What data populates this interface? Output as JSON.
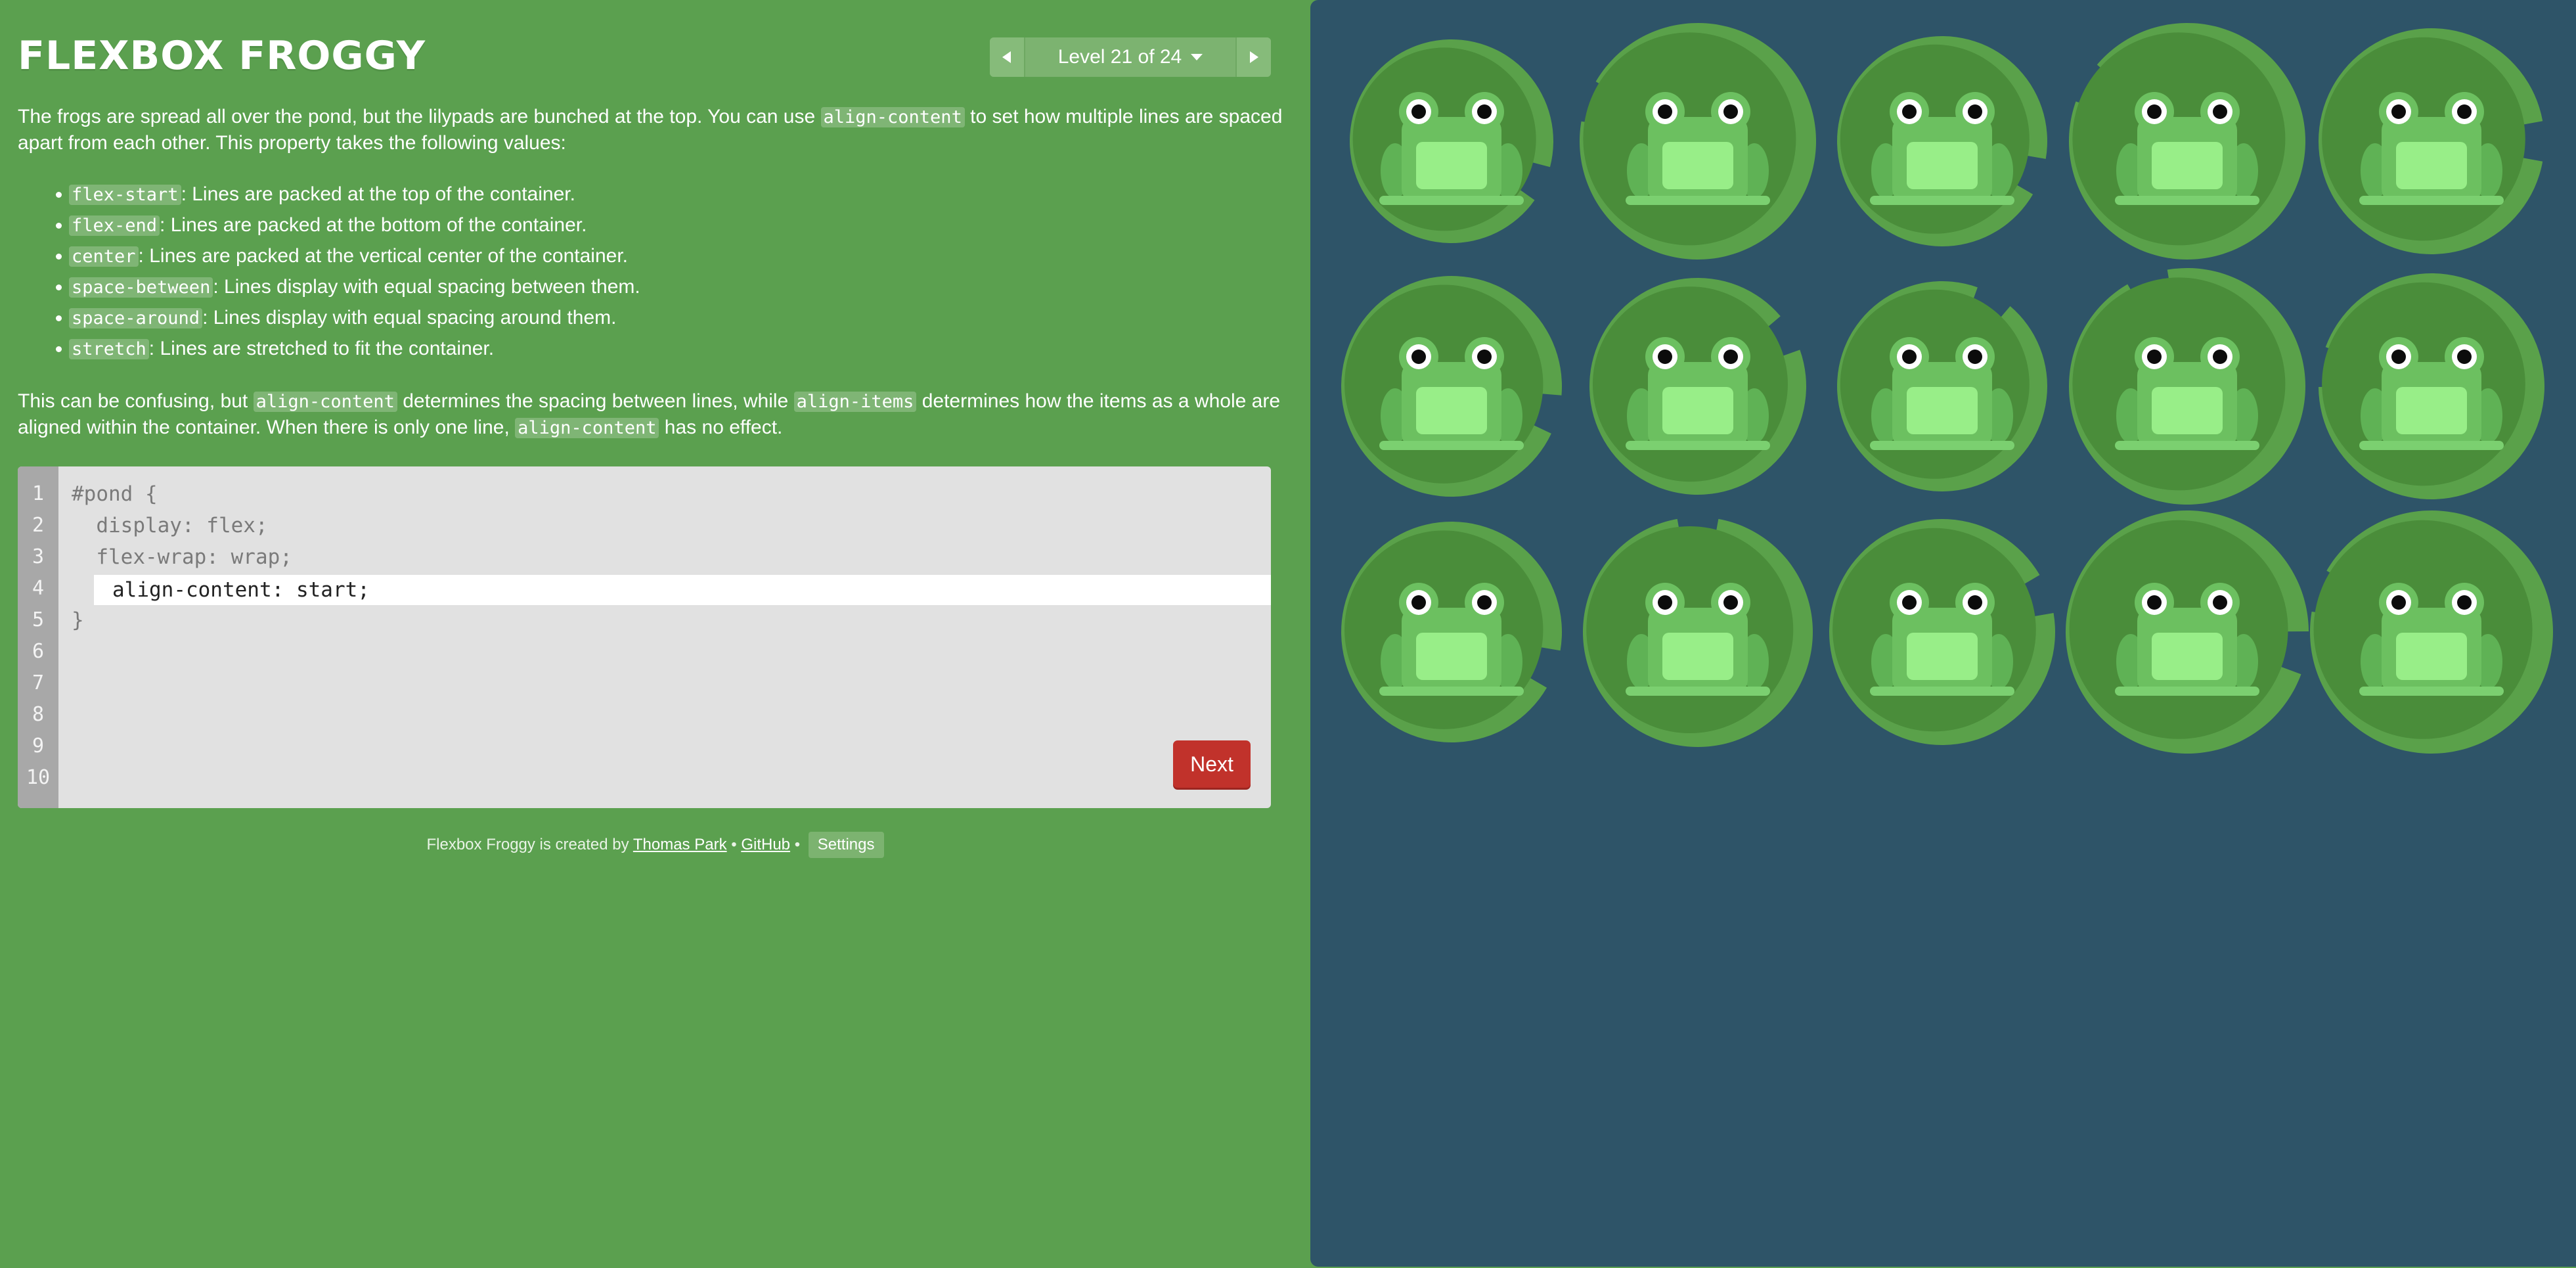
{
  "app": {
    "title": "FLEXBOX FROGGY",
    "level": "Level 21 of 24"
  },
  "instructions": {
    "intro_before": "The frogs are spread all over the pond, but the lilypads are bunched at the top. You can use ",
    "intro_code": "align-content",
    "intro_after": " to set how multiple lines are spaced apart from each other. This property takes the following values:",
    "values": [
      {
        "code": "flex-start",
        "text": ": Lines are packed at the top of the container."
      },
      {
        "code": "flex-end",
        "text": ": Lines are packed at the bottom of the container."
      },
      {
        "code": "center",
        "text": ": Lines are packed at the vertical center of the container."
      },
      {
        "code": "space-between",
        "text": ": Lines display with equal spacing between them."
      },
      {
        "code": "space-around",
        "text": ": Lines display with equal spacing around them."
      },
      {
        "code": "stretch",
        "text": ": Lines are stretched to fit the container."
      }
    ],
    "p2_a": "This can be confusing, but ",
    "p2_code1": "align-content",
    "p2_b": " determines the spacing between lines, while ",
    "p2_code2": "align-items",
    "p2_c": " determines how the items as a whole are aligned within the container. When there is only one line, ",
    "p2_code3": "align-content",
    "p2_d": " has no effect."
  },
  "editor": {
    "line_numbers": [
      "1",
      "2",
      "3",
      "4",
      "5",
      "6",
      "7",
      "8",
      "9",
      "10"
    ],
    "lines": [
      "#pond {",
      "  display: flex;",
      "  flex-wrap: wrap;",
      "",
      "}"
    ],
    "input_value": "align-content: start;",
    "next_label": "Next"
  },
  "footer": {
    "credit_text": "Flexbox Froggy is created by ",
    "author": "Thomas Park",
    "separator": " • ",
    "github": "GitHub",
    "settings": "Settings"
  },
  "colors": {
    "sidebar_bg": "#5ba04f",
    "pond_bg": "#2e5468",
    "lilypad": "#4a8d3a",
    "lilypad_rim": "#5aa14a",
    "frog": "#6cc060",
    "next_button": "#c1322b"
  }
}
